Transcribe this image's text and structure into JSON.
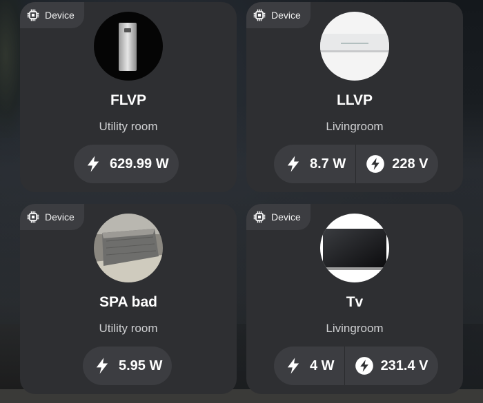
{
  "devices": [
    {
      "badge": "Device",
      "name": "FLVP",
      "room": "Utility room",
      "power": "629.99 W",
      "voltage": null,
      "image": "heat-pump-appliance"
    },
    {
      "badge": "Device",
      "name": "LLVP",
      "room": "Livingroom",
      "power": "8.7 W",
      "voltage": "228 V",
      "image": "air-conditioner-unit"
    },
    {
      "badge": "Device",
      "name": "SPA bad",
      "room": "Utility room",
      "power": "5.95 W",
      "voltage": null,
      "image": "hot-tub-spa"
    },
    {
      "badge": "Device",
      "name": "Tv",
      "room": "Livingroom",
      "power": "4 W",
      "voltage": "231.4 V",
      "image": "television"
    }
  ],
  "icons": {
    "badge": "chip-icon",
    "power": "lightning-bolt-icon",
    "voltage": "voltage-circle-icon"
  }
}
